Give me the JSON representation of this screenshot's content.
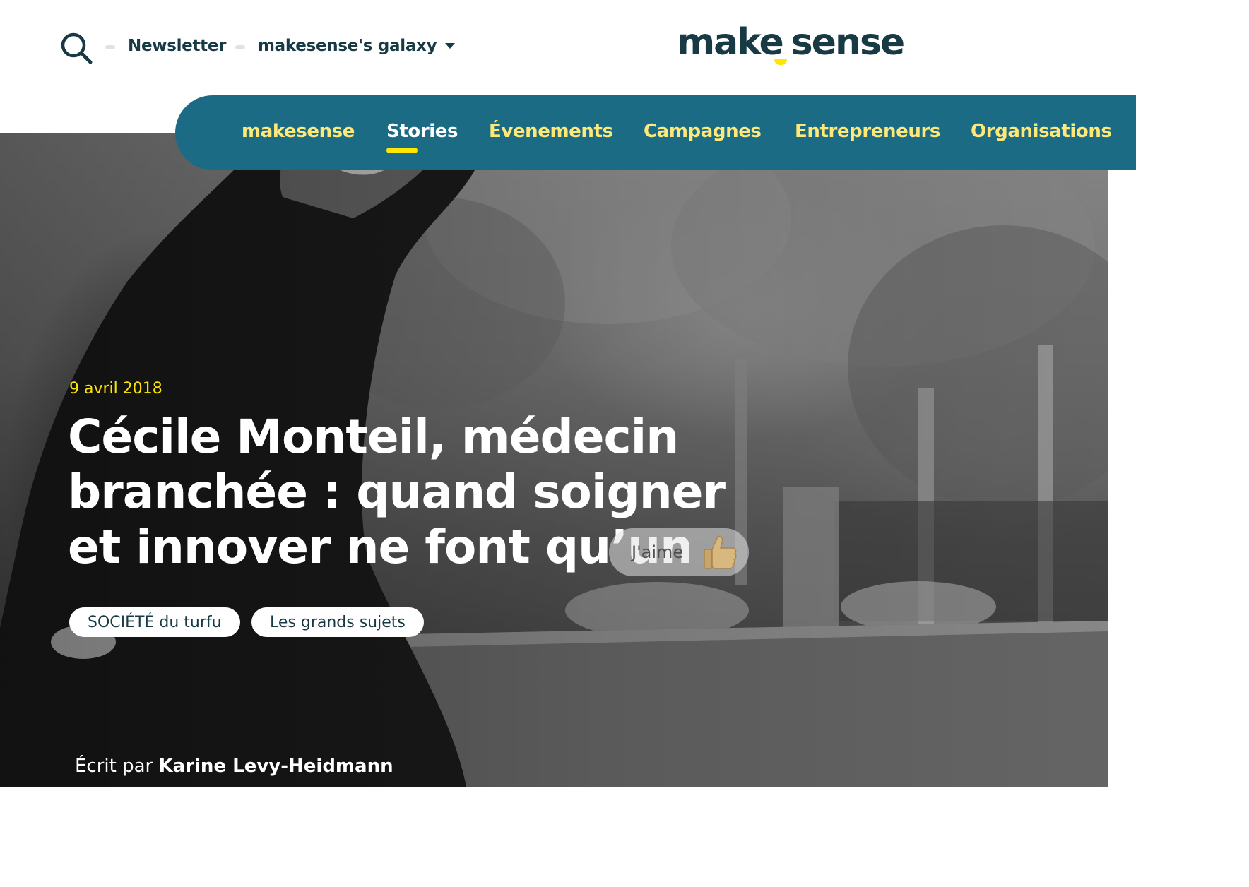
{
  "header": {
    "newsletter_label": "Newsletter",
    "galaxy_label": "makesense's galaxy",
    "logo_left": "make",
    "logo_right": "sense"
  },
  "nav": {
    "items": [
      {
        "label": "makesense"
      },
      {
        "label": "Stories"
      },
      {
        "label": "Évenements"
      },
      {
        "label": "Campagnes"
      },
      {
        "label": "Entrepreneurs"
      },
      {
        "label": "Organisations"
      }
    ],
    "active": "Stories"
  },
  "article": {
    "date": "9 avril 2018",
    "title": "Cécile Monteil, médecin branchée : quand soigner et innover ne font qu’un",
    "like_label": "J'aime",
    "tags": [
      {
        "label": "SOCIÉTÉ du turfu"
      },
      {
        "label": "Les grands sujets"
      }
    ],
    "byline_prefix": "Écrit par",
    "author": "Karine Levy-Heidmann"
  },
  "colors": {
    "brand_dark": "#173a44",
    "nav_background": "#1b6b85",
    "nav_text": "#ffe878",
    "accent_yellow": "#ffe600"
  },
  "icons": {
    "search": "search-icon",
    "caret": "caret-down-icon",
    "like": "thumbs-up-icon"
  }
}
